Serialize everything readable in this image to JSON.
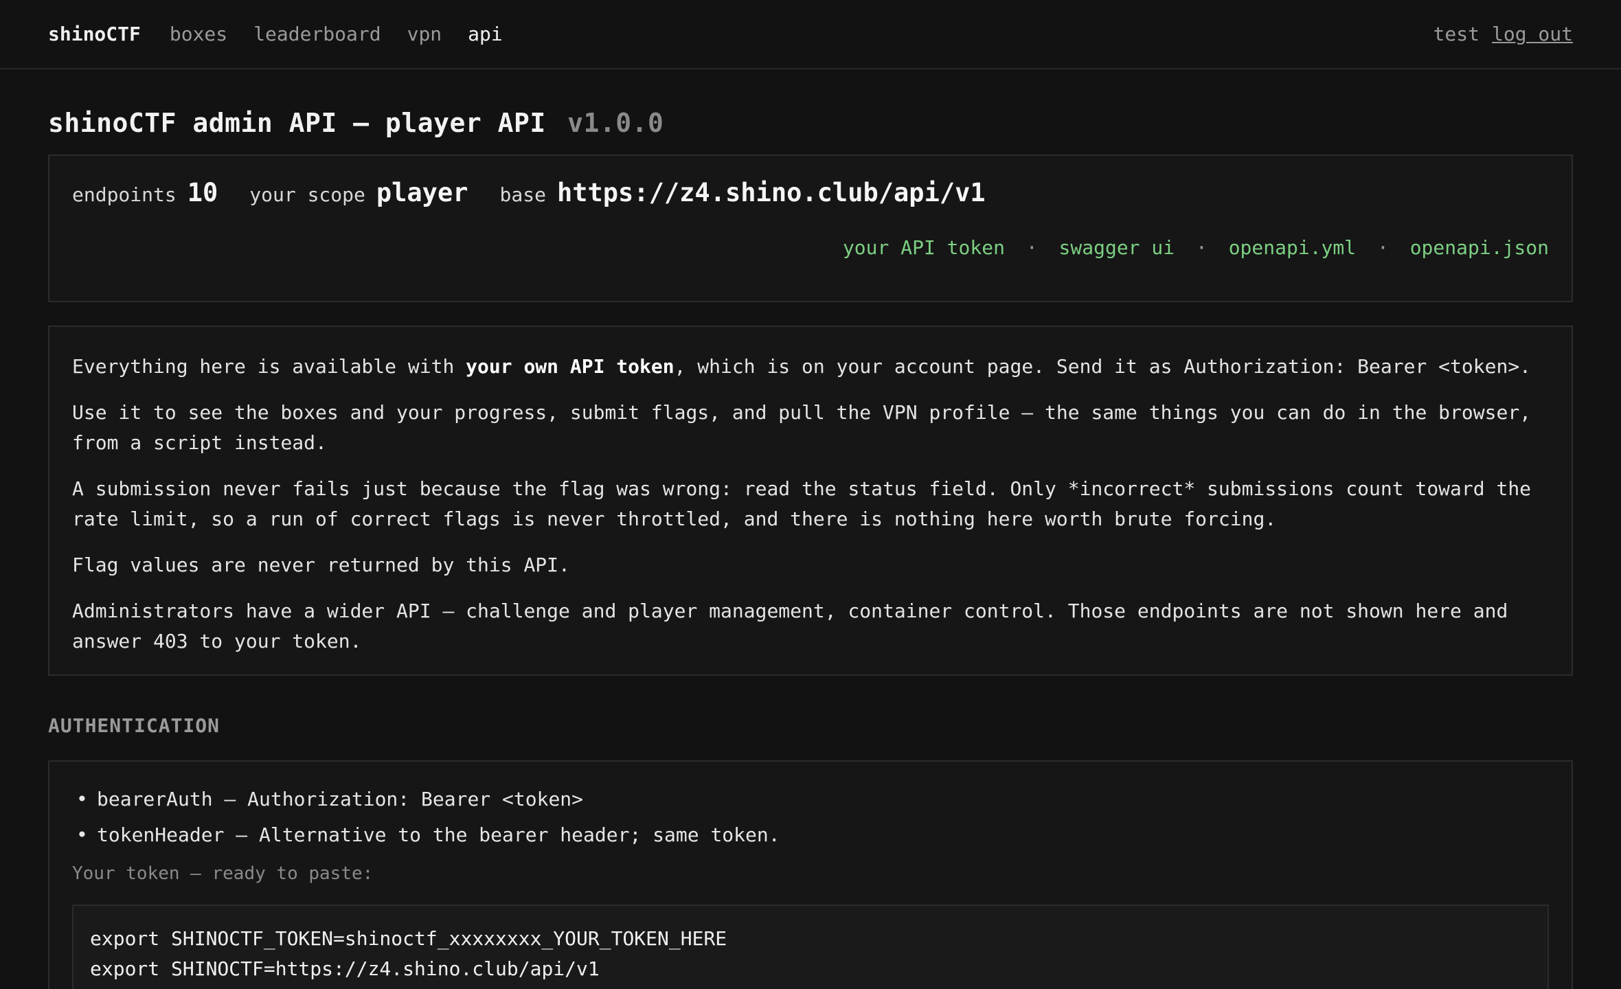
{
  "nav": {
    "brand": "shinoCTF",
    "links": [
      "boxes",
      "leaderboard",
      "vpn",
      "api"
    ],
    "active": "api",
    "user": "test",
    "logout": "log out"
  },
  "header": {
    "title": "shinoCTF admin API — player API",
    "version": "v1.0.0"
  },
  "summary": {
    "endpoints_label": "endpoints",
    "endpoints_value": "10",
    "scope_label": "your scope",
    "scope_value": "player",
    "base_label": "base",
    "base_value": "https://z4.shino.club/api/v1",
    "links": [
      "your API token",
      "swagger ui",
      "openapi.yml",
      "openapi.json"
    ],
    "separator": "·"
  },
  "info": {
    "p1_before": "Everything here is available with ",
    "p1_bold": "your own API token",
    "p1_after": ", which is on your account page. Send it as Authorization: Bearer <token>.",
    "p2": "Use it to see the boxes and your progress, submit flags, and pull the VPN profile — the same things you can do in the browser, from a script instead.",
    "p3": "A submission never fails just because the flag was wrong: read the status field. Only *incorrect* submissions count toward the rate limit, so a run of correct flags is never throttled, and there is nothing here worth brute forcing.",
    "p4": "Flag values are never returned by this API.",
    "p5": "Administrators have a wider API — challenge and player management, container control. Those endpoints are not shown here and answer 403 to your token."
  },
  "auth": {
    "heading": "AUTHENTICATION",
    "items": [
      "bearerAuth — Authorization: Bearer <token>",
      "tokenHeader — Alternative to the bearer header; same token."
    ],
    "hint": "Your token — ready to paste:",
    "code": [
      "export SHINOCTF_TOKEN=shinoctf_xxxxxxxx_YOUR_TOKEN_HERE",
      "export SHINOCTF=https://z4.shino.club/api/v1"
    ]
  },
  "colors": {
    "background": "#121212",
    "panel": "#161616",
    "border": "#2c2c2c",
    "link_green": "#7ccf83",
    "muted": "#9a9a9a"
  }
}
